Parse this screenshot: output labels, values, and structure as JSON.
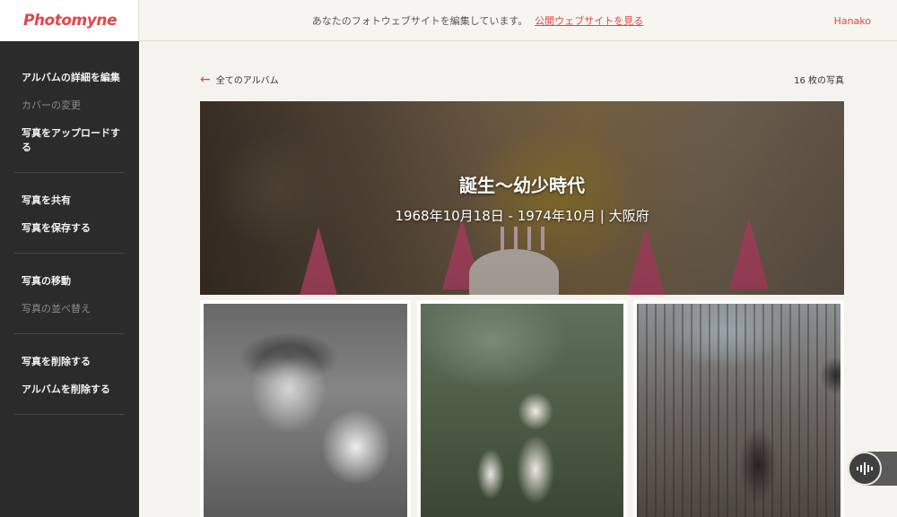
{
  "header": {
    "logo": "Photomyne",
    "notice": "あなたのフォトウェブサイトを編集しています。",
    "notice_link": "公開ウェブサイトを見る",
    "user": "Hanako"
  },
  "sidebar": {
    "items": [
      {
        "label": "アルバムの詳細を編集",
        "enabled": true
      },
      {
        "label": "カバーの変更",
        "enabled": false
      },
      {
        "label": "写真をアップロードする",
        "enabled": true
      },
      {
        "label": "写真を共有",
        "enabled": true
      },
      {
        "label": "写真を保存する",
        "enabled": true
      },
      {
        "label": "写真の移動",
        "enabled": true
      },
      {
        "label": "写真の並べ替え",
        "enabled": false
      },
      {
        "label": "写真を削除する",
        "enabled": true
      },
      {
        "label": "アルバムを削除する",
        "enabled": true
      }
    ]
  },
  "main": {
    "back_label": "全てのアルバム",
    "photo_count": "16 枚の写真",
    "cover": {
      "title": "誕生〜幼少時代",
      "subtitle": "1968年10月18日 - 1974年10月 | 大阪府"
    },
    "photos": [
      "photo-1",
      "photo-2",
      "photo-3"
    ]
  },
  "colors": {
    "accent": "#e2454a",
    "sidebar_bg": "#2b2b2b",
    "page_bg": "#f5f3ee"
  },
  "icons": {
    "back": "arrow-left-icon",
    "fab": "audio-wave-icon"
  }
}
